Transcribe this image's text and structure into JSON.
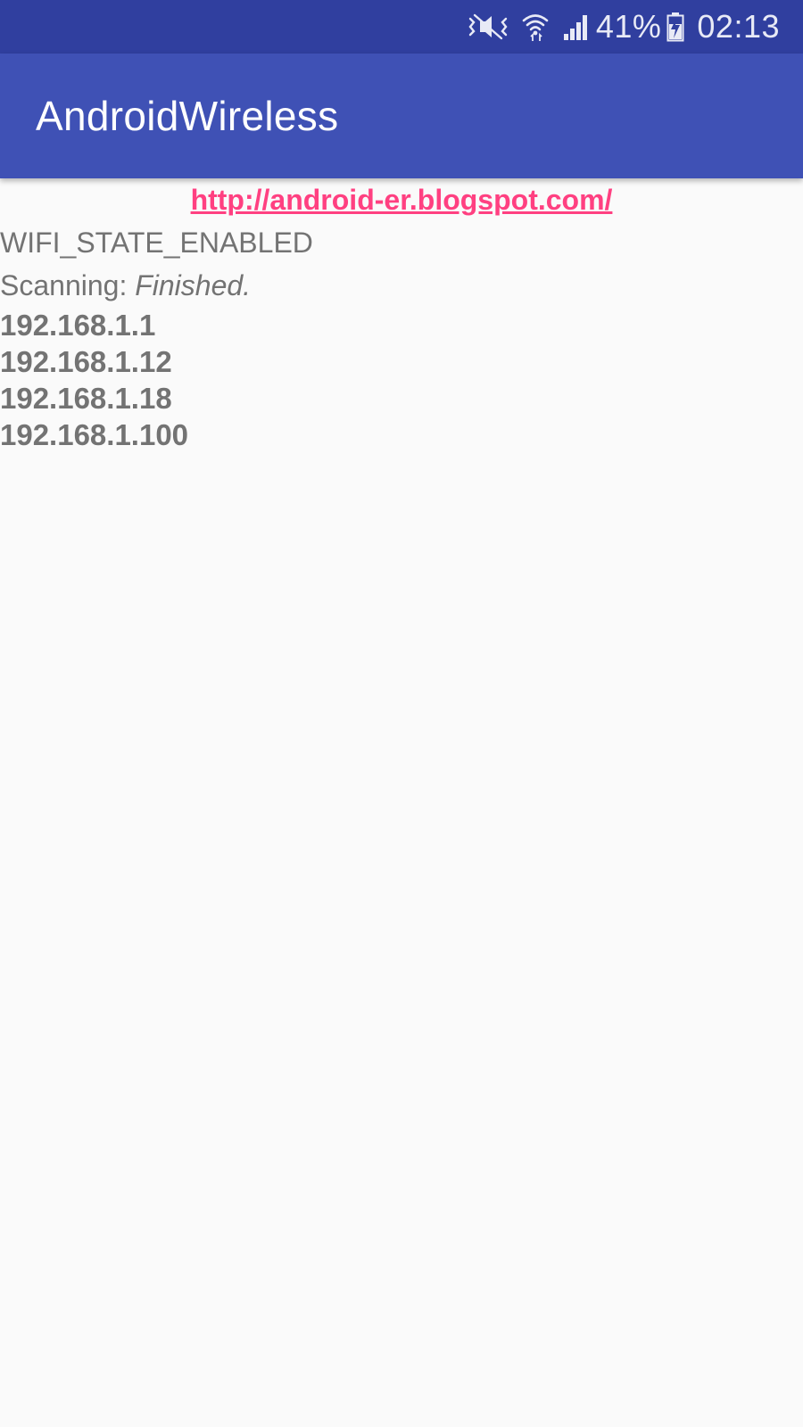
{
  "status_bar": {
    "battery": "41%",
    "time": "02:13",
    "icons": [
      "mute-vibrate-icon",
      "wifi-icon",
      "signal-icon",
      "battery-charging-icon"
    ],
    "text_color": "#e8eaf6",
    "background": "#303f9f"
  },
  "app_bar": {
    "title": "AndroidWireless",
    "background": "#3f51b5"
  },
  "content": {
    "link": "http://android-er.blogspot.com/",
    "link_color": "#ff4081",
    "wifi_state": "WIFI_STATE_ENABLED",
    "scan_label": "Scanning: ",
    "scan_value": "Finished.",
    "ip_addresses": [
      "192.168.1.1",
      "192.168.1.12",
      "192.168.1.18",
      "192.168.1.100"
    ],
    "text_color": "#737373"
  }
}
